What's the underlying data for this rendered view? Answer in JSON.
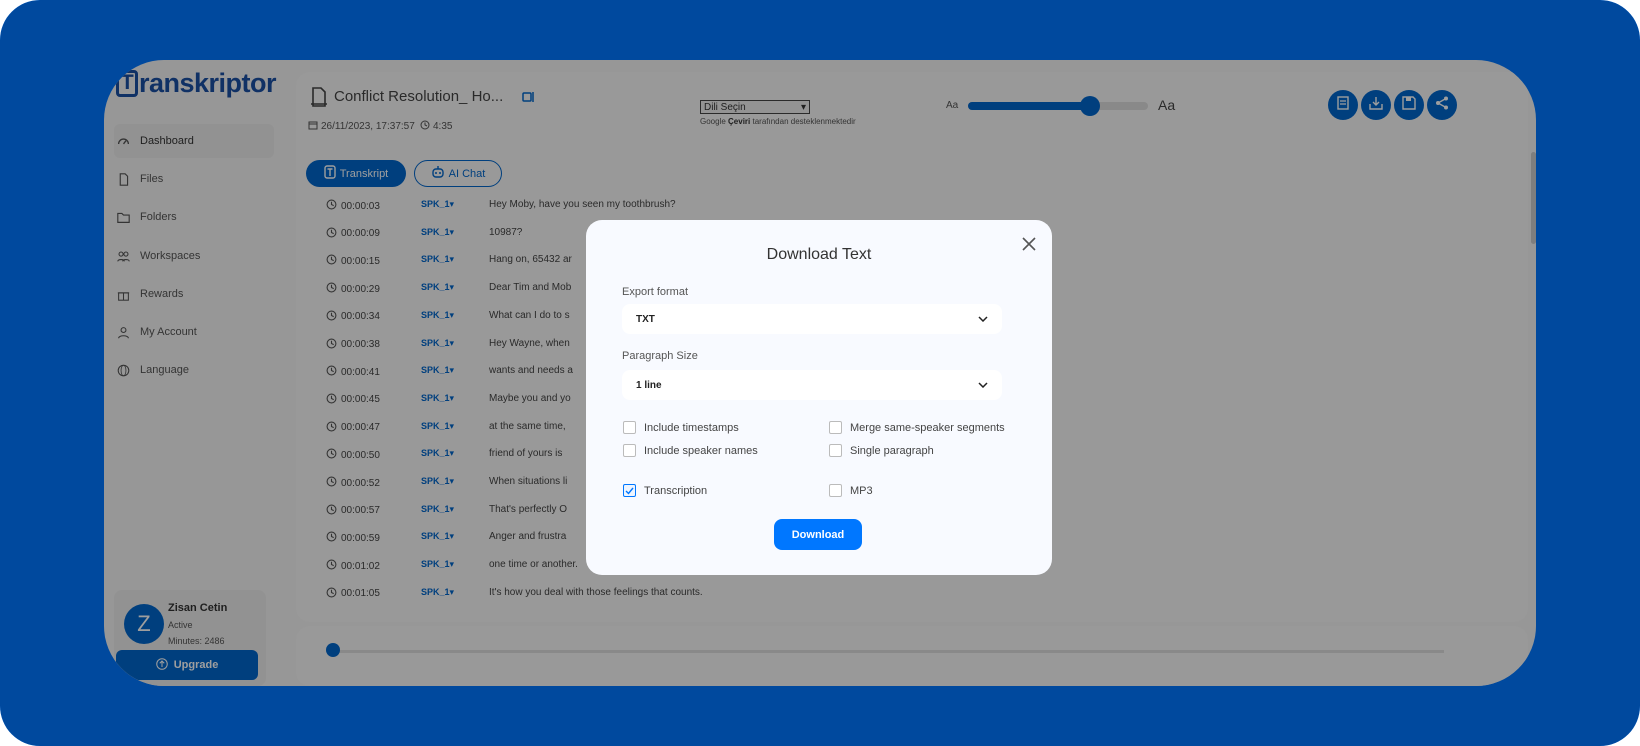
{
  "brand": {
    "logo_initial": "T",
    "logo_rest": "ranskriptor"
  },
  "sidebar": {
    "items": [
      {
        "label": "Dashboard",
        "icon": "dashboard-icon"
      },
      {
        "label": "Files",
        "icon": "file-icon"
      },
      {
        "label": "Folders",
        "icon": "folder-icon"
      },
      {
        "label": "Workspaces",
        "icon": "users-icon"
      },
      {
        "label": "Rewards",
        "icon": "gift-icon"
      },
      {
        "label": "My Account",
        "icon": "user-icon"
      },
      {
        "label": "Language",
        "icon": "globe-icon"
      }
    ],
    "active": "Dashboard"
  },
  "user": {
    "avatar_letter": "Z",
    "name": "Zisan Cetin",
    "status": "Active",
    "minutes": "Minutes: 2486",
    "upgrade_label": "Upgrade"
  },
  "header": {
    "title": "Conflict Resolution_ Ho...",
    "date": "26/11/2023, 17:37:57",
    "duration": "4:35",
    "language_select": "Dili Seçin",
    "google_brand": "Google",
    "google_service": "Çeviri",
    "google_suffix": "tarafından desteklenmektedir",
    "font_small": "Aa",
    "font_big": "Aa",
    "font_size_level": 0.68
  },
  "tabs": {
    "transkript": "Transkript",
    "ai_chat": "AI Chat"
  },
  "transcript": [
    {
      "time": "00:00:03",
      "speaker": "SPK_1",
      "text": "Hey Moby, have you seen my toothbrush?"
    },
    {
      "time": "00:00:09",
      "speaker": "SPK_1",
      "text": "10987?"
    },
    {
      "time": "00:00:15",
      "speaker": "SPK_1",
      "text": "Hang on, 65432 ar"
    },
    {
      "time": "00:00:29",
      "speaker": "SPK_1",
      "text": "Dear Tim and Mob"
    },
    {
      "time": "00:00:34",
      "speaker": "SPK_1",
      "text": "What can I do to s"
    },
    {
      "time": "00:00:38",
      "speaker": "SPK_1",
      "text": "Hey Wayne, when"
    },
    {
      "time": "00:00:41",
      "speaker": "SPK_1",
      "text": "wants and needs a"
    },
    {
      "time": "00:00:45",
      "speaker": "SPK_1",
      "text": "Maybe you and yo"
    },
    {
      "time": "00:00:47",
      "speaker": "SPK_1",
      "text": "at the same time,"
    },
    {
      "time": "00:00:50",
      "speaker": "SPK_1",
      "text": "friend of yours is"
    },
    {
      "time": "00:00:52",
      "speaker": "SPK_1",
      "text": "When situations li"
    },
    {
      "time": "00:00:57",
      "speaker": "SPK_1",
      "text": "That's perfectly O"
    },
    {
      "time": "00:00:59",
      "speaker": "SPK_1",
      "text": "Anger and frustra"
    },
    {
      "time": "00:01:02",
      "speaker": "SPK_1",
      "text": "one time or another."
    },
    {
      "time": "00:01:05",
      "speaker": "SPK_1",
      "text": "It's how you deal with those feelings that counts."
    }
  ],
  "player": {
    "progress": 0.0
  },
  "modal": {
    "title": "Download Text",
    "export_label": "Export format",
    "export_value": "TXT",
    "paragraph_label": "Paragraph Size",
    "paragraph_value": "1 line",
    "options": [
      {
        "label": "Include timestamps",
        "checked": false
      },
      {
        "label": "Merge same-speaker segments",
        "checked": false
      },
      {
        "label": "Include speaker names",
        "checked": false
      },
      {
        "label": "Single paragraph",
        "checked": false
      },
      {
        "label": "Transcription",
        "checked": true
      },
      {
        "label": "MP3",
        "checked": false
      }
    ],
    "download_label": "Download"
  },
  "colors": {
    "brand_blue": "#0077ff",
    "app_blue": "#0066cc",
    "overlay": "rgba(0,0,0,0.38)"
  }
}
